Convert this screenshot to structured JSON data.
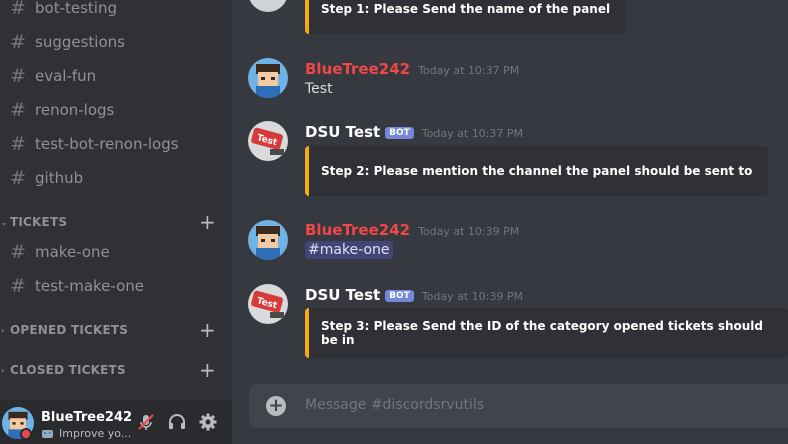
{
  "sidebar": {
    "channels_top": [
      {
        "name": "bot-testing"
      },
      {
        "name": "suggestions"
      },
      {
        "name": "eval-fun"
      },
      {
        "name": "renon-logs"
      },
      {
        "name": "test-bot-renon-logs"
      },
      {
        "name": "github"
      }
    ],
    "categories": [
      {
        "label": "TICKETS",
        "channels": [
          {
            "name": "make-one"
          },
          {
            "name": "test-make-one"
          }
        ]
      },
      {
        "label": "OPENED TICKETS",
        "channels": []
      },
      {
        "label": "CLOSED TICKETS",
        "channels": []
      }
    ]
  },
  "user_panel": {
    "username": "BlueTree242",
    "custom_status": "Improve yo..."
  },
  "messages": [
    {
      "type": "embed_only",
      "embed_text": "Step 1: Please Send the name of the panel"
    },
    {
      "author": "BlueTree242",
      "timestamp": "Today at 10:37 PM",
      "text": "Test"
    },
    {
      "author": "DSU Test",
      "badge": "BOT",
      "timestamp": "Today at 10:37 PM",
      "embed_text": "Step 2: Please mention the channel the panel should be sent to"
    },
    {
      "author": "BlueTree242",
      "timestamp": "Today at 10:39 PM",
      "mention": "#make-one"
    },
    {
      "author": "DSU Test",
      "badge": "BOT",
      "timestamp": "Today at 10:39 PM",
      "embed_text": "Step 3: Please Send the ID of the category opened tickets should be in"
    }
  ],
  "composer": {
    "placeholder": "Message #discordsrvutils"
  },
  "colors": {
    "sidebar_bg": "#2f3136",
    "main_bg": "#36393f",
    "user_panel_bg": "#292b2f",
    "embed_accent": "#faa61a",
    "user_name_red": "#f04747",
    "bot_badge": "#7289da",
    "mention_bg": "#414675"
  },
  "icons": [
    "hash-icon",
    "plus-icon",
    "chevron-down-icon",
    "mute-mic-icon",
    "headphones-icon",
    "gear-icon",
    "add-attachment-icon"
  ]
}
